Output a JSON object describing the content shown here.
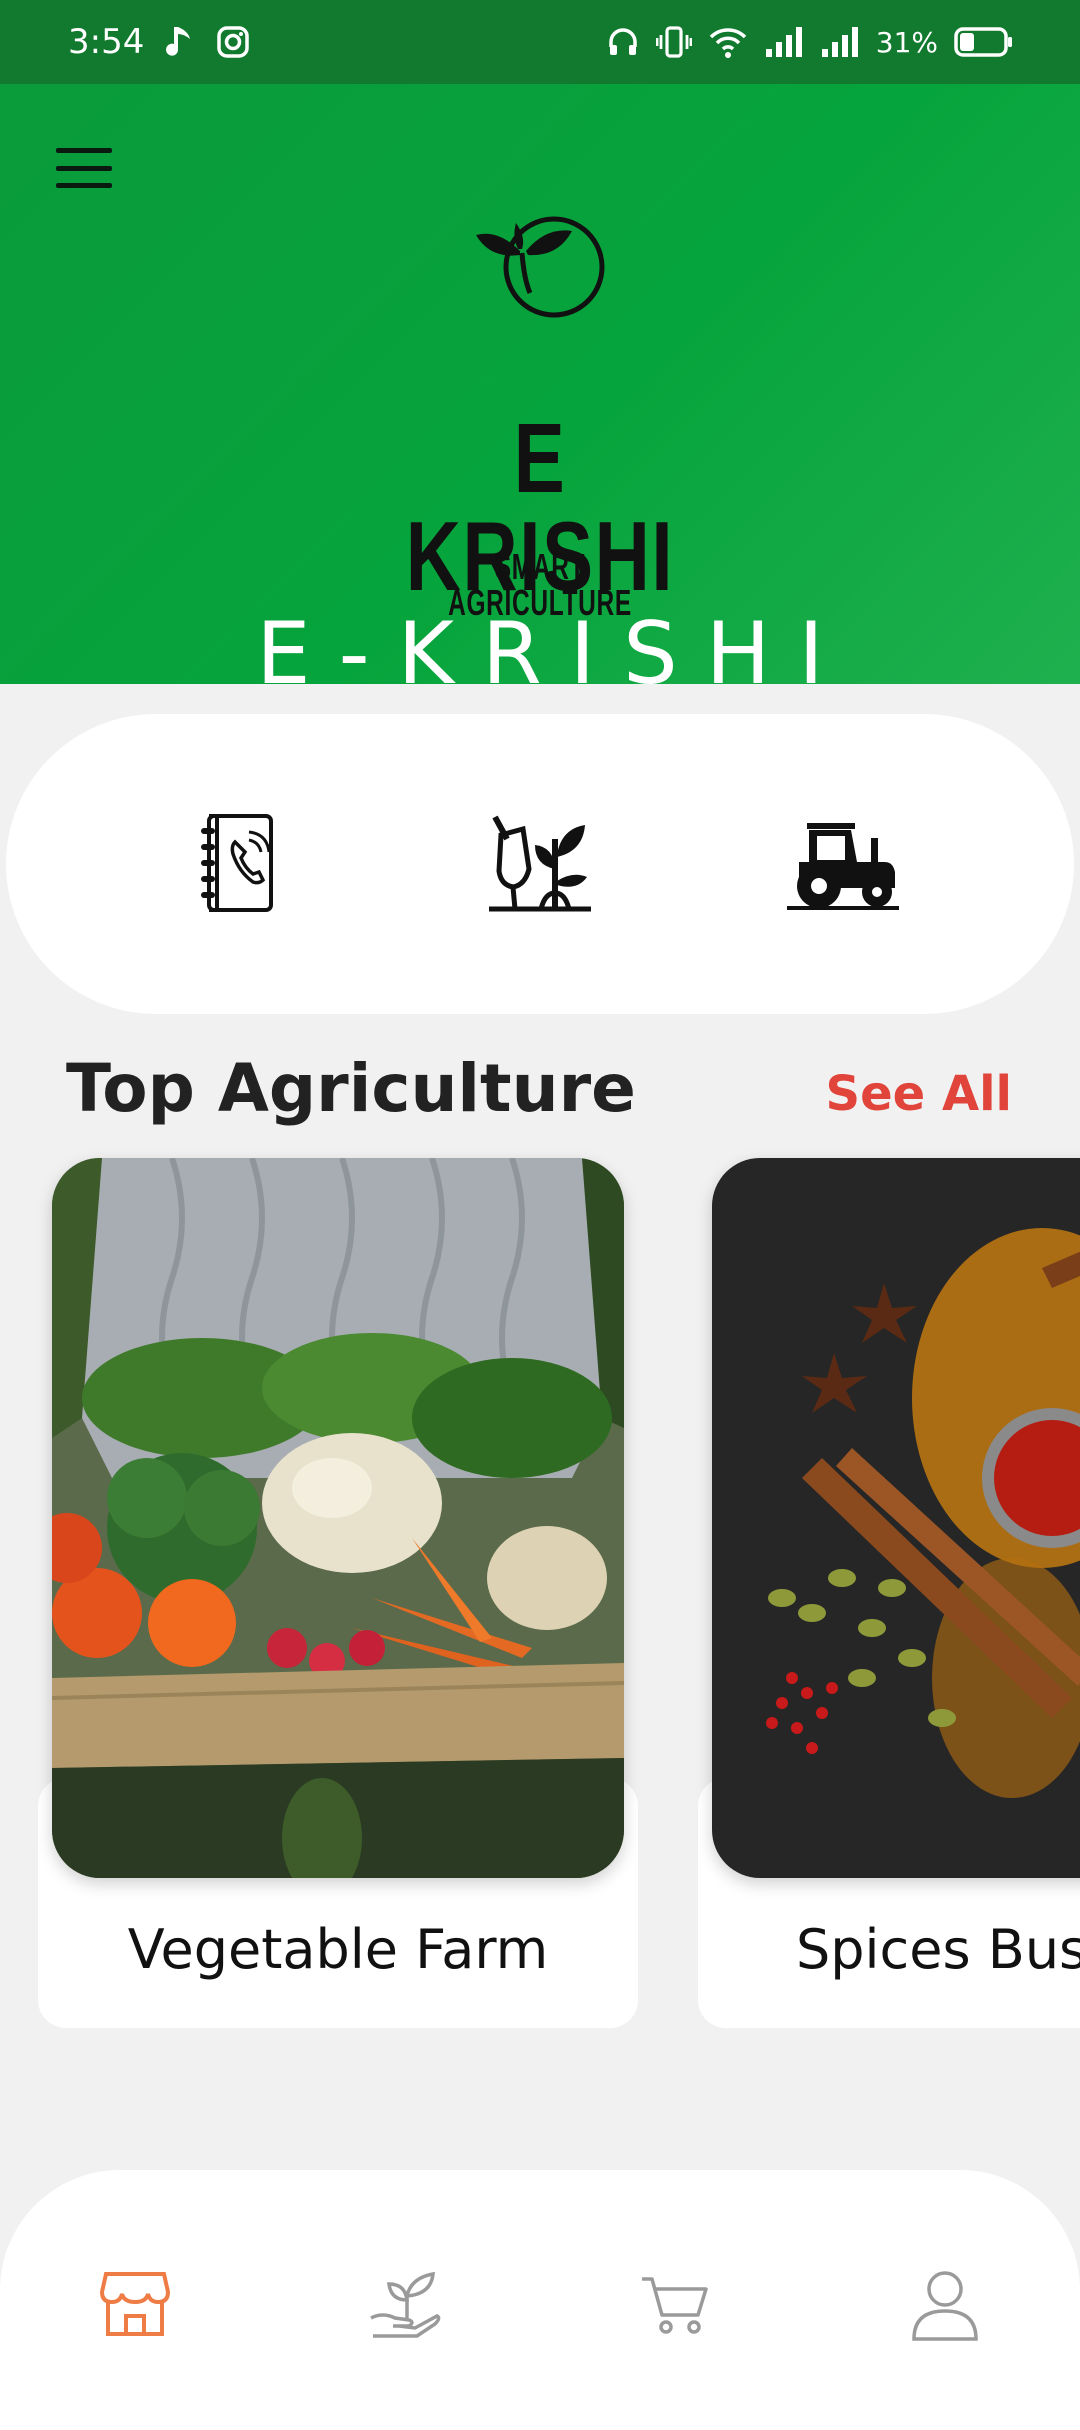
{
  "status_bar": {
    "time": "3:54",
    "battery": "31%",
    "left_icons": [
      "music-note-icon",
      "instagram-icon"
    ],
    "right_icons": [
      "headphones-icon",
      "vibrate-icon",
      "wifi-icon",
      "signal-icon",
      "signal-icon",
      "battery-icon"
    ]
  },
  "header": {
    "menu_icon": "hamburger-menu-icon",
    "logo_title": "E KRISHI",
    "logo_subtitle": "SMART AGRICULTURE",
    "brand_name": "E-KRISHI",
    "colors": {
      "green": "#06a43c",
      "dark_green": "#117a2f"
    }
  },
  "quick_actions": [
    {
      "icon": "contact-book-icon"
    },
    {
      "icon": "gardening-plant-icon"
    },
    {
      "icon": "tractor-icon"
    }
  ],
  "section": {
    "title": "Top Agriculture",
    "see_all": "See All",
    "see_all_color": "#e0443a"
  },
  "cards": [
    {
      "label": "Vegetable Farm",
      "image": "vegetables-crate-photo"
    },
    {
      "label": "Spices Busi",
      "image": "spices-photo"
    }
  ],
  "bottom_nav": [
    {
      "icon": "store-icon",
      "active": true,
      "active_color": "#ef7b45"
    },
    {
      "icon": "plant-hand-icon",
      "active": false
    },
    {
      "icon": "cart-icon",
      "active": false
    },
    {
      "icon": "user-icon",
      "active": false
    }
  ]
}
